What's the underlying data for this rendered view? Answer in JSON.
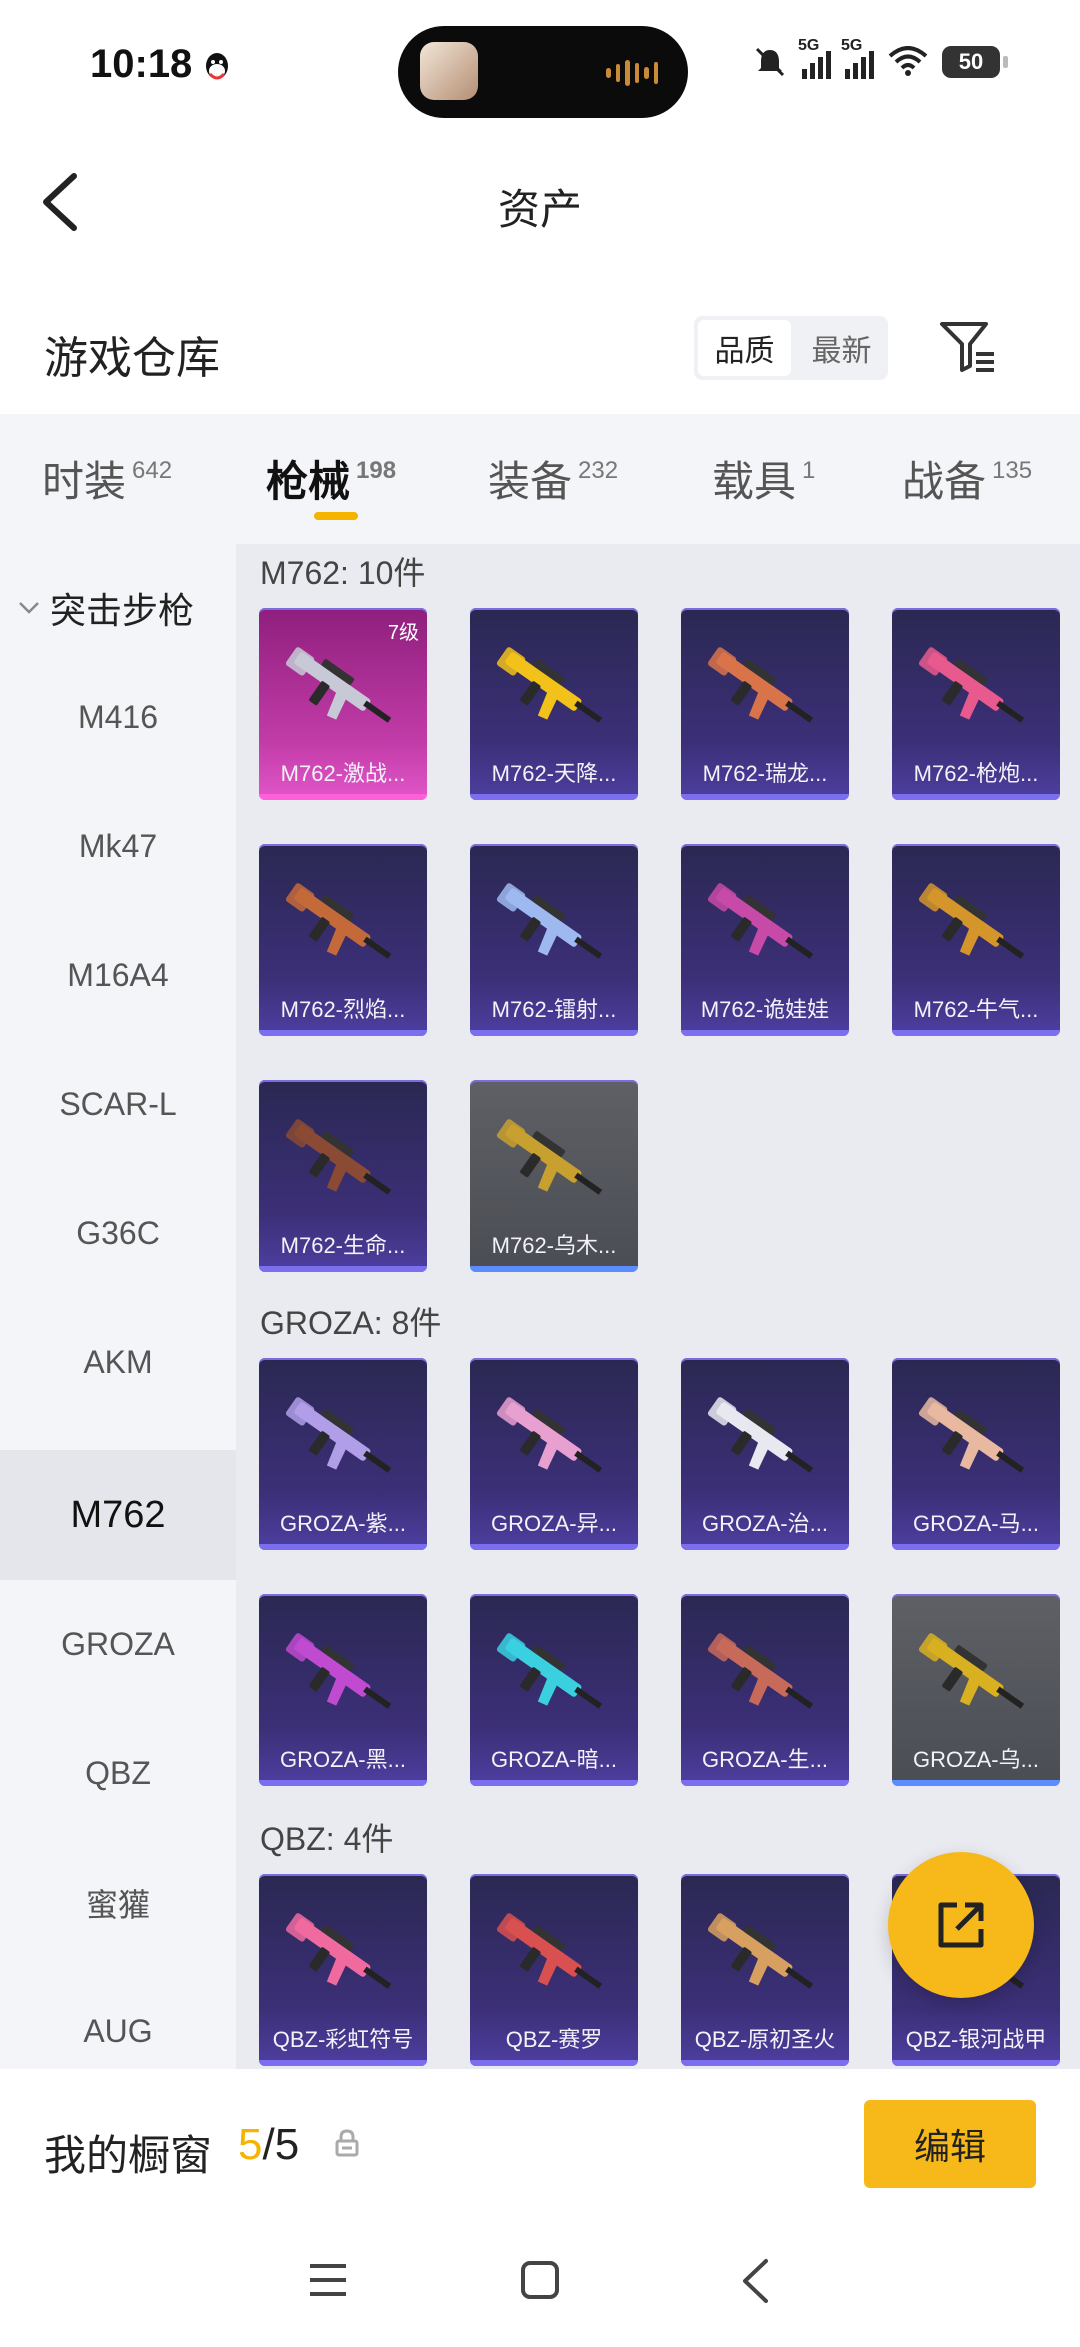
{
  "status_bar": {
    "time": "10:18",
    "battery": "50",
    "signal_1": "5G",
    "signal_2": "5G"
  },
  "header": {
    "title": "资产"
  },
  "section": {
    "title": "游戏仓库",
    "sort_options": [
      "品质",
      "最新"
    ],
    "active_sort": "品质"
  },
  "tabs": [
    {
      "label": "时装",
      "count": "642"
    },
    {
      "label": "枪械",
      "count": "198",
      "active": true
    },
    {
      "label": "装备",
      "count": "232"
    },
    {
      "label": "载具",
      "count": "1"
    },
    {
      "label": "战备",
      "count": "135"
    }
  ],
  "sidebar": {
    "category": "突击步枪",
    "items": [
      "M416",
      "Mk47",
      "M16A4",
      "SCAR-L",
      "G36C",
      "AKM",
      "M762",
      "GROZA",
      "QBZ",
      "蜜獾",
      "AUG"
    ],
    "active": "M762"
  },
  "groups": [
    {
      "label": "M762: 10件",
      "items": [
        {
          "name": "M762-激战...",
          "level": "7级",
          "style": "pink",
          "gun": "#c7c9d6"
        },
        {
          "name": "M762-天降...",
          "style": "purple",
          "gun": "#f2c21b"
        },
        {
          "name": "M762-瑞龙...",
          "style": "purple",
          "gun": "#d9734a"
        },
        {
          "name": "M762-枪炮...",
          "style": "purple",
          "gun": "#e85a8e"
        },
        {
          "name": "M762-烈焰...",
          "style": "purple",
          "gun": "#c46a3a"
        },
        {
          "name": "M762-镭射...",
          "style": "purple",
          "gun": "#9eb8f0"
        },
        {
          "name": "M762-诡娃娃",
          "style": "purple",
          "gun": "#c84aa8"
        },
        {
          "name": "M762-牛气...",
          "style": "purple",
          "gun": "#d4962a"
        },
        {
          "name": "M762-生命...",
          "style": "purple",
          "gun": "#8a4a34"
        },
        {
          "name": "M762-乌木...",
          "style": "gray",
          "gun": "#c8a030"
        }
      ]
    },
    {
      "label": "GROZA: 8件",
      "items": [
        {
          "name": "GROZA-紫...",
          "style": "purple",
          "gun": "#b09ee8"
        },
        {
          "name": "GROZA-异...",
          "style": "purple",
          "gun": "#e8a0d0"
        },
        {
          "name": "GROZA-治...",
          "style": "purple",
          "gun": "#e8e8f0"
        },
        {
          "name": "GROZA-马...",
          "style": "purple",
          "gun": "#e8b8a0"
        },
        {
          "name": "GROZA-黑...",
          "style": "purple",
          "gun": "#c04ad0"
        },
        {
          "name": "GROZA-暗...",
          "style": "purple",
          "gun": "#3ad0e0"
        },
        {
          "name": "GROZA-生...",
          "style": "purple",
          "gun": "#c86a5a"
        },
        {
          "name": "GROZA-乌...",
          "style": "gray",
          "gun": "#d8b020"
        }
      ]
    },
    {
      "label": "QBZ: 4件",
      "items": [
        {
          "name": "QBZ-彩虹符号",
          "style": "purple",
          "gun": "#f06aa0"
        },
        {
          "name": "QBZ-赛罗",
          "style": "purple",
          "gun": "#d85050"
        },
        {
          "name": "QBZ-原初圣火",
          "style": "purple",
          "gun": "#d8a060"
        },
        {
          "name": "QBZ-银河战甲",
          "style": "purple",
          "gun": "#9a9ac8"
        }
      ]
    }
  ],
  "bottom": {
    "showcase_label": "我的橱窗",
    "showcase_current": "5",
    "showcase_sep_total": "/5",
    "edit_label": "编辑"
  },
  "colors": {
    "accent": "#f7b81a",
    "card_purple": "#3c2f78",
    "card_gray": "#55575e",
    "card_pink": "#c23ca8"
  }
}
